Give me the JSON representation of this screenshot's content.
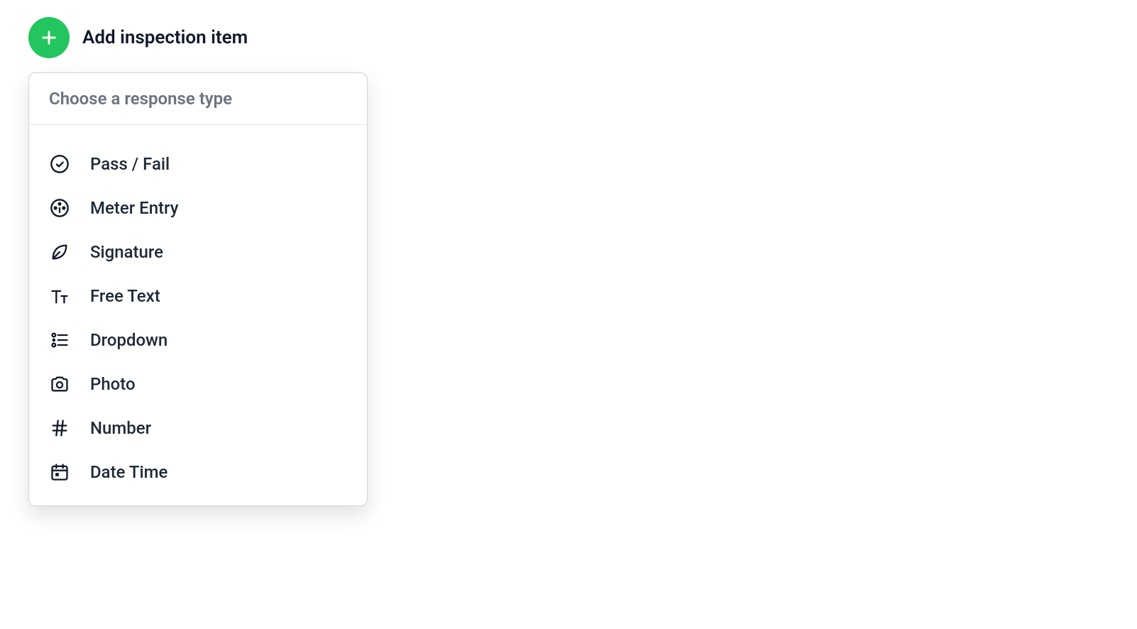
{
  "header": {
    "add_label": "Add inspection item"
  },
  "dropdown": {
    "title": "Choose a response type",
    "options": [
      {
        "label": "Pass / Fail",
        "icon": "check-circle-icon"
      },
      {
        "label": "Meter Entry",
        "icon": "meter-icon"
      },
      {
        "label": "Signature",
        "icon": "leaf-icon"
      },
      {
        "label": "Free Text",
        "icon": "text-icon"
      },
      {
        "label": "Dropdown",
        "icon": "list-icon"
      },
      {
        "label": "Photo",
        "icon": "camera-icon"
      },
      {
        "label": "Number",
        "icon": "hash-icon"
      },
      {
        "label": "Date Time",
        "icon": "calendar-icon"
      }
    ]
  }
}
